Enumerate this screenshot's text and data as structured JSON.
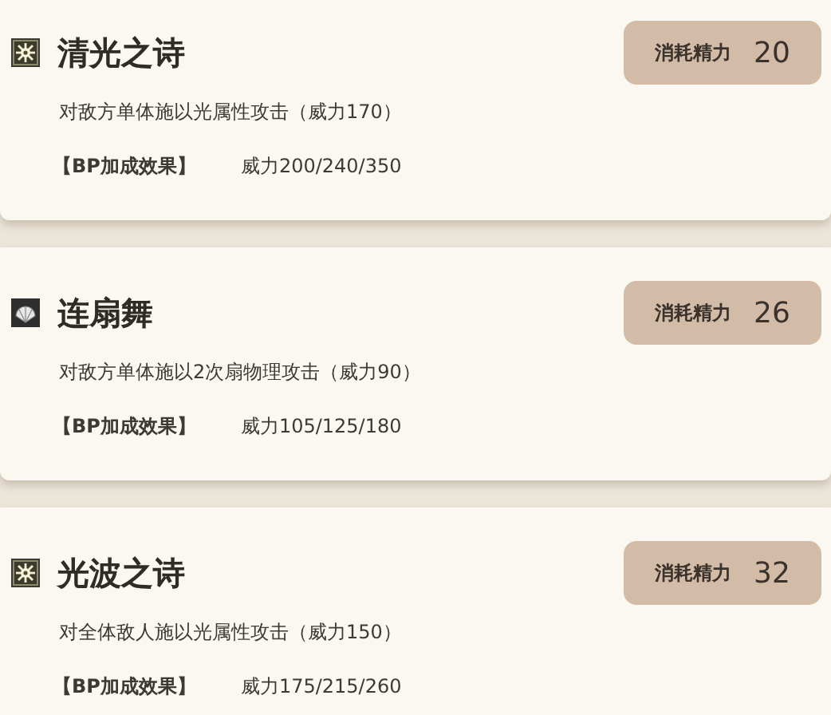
{
  "skills": [
    {
      "kind": "light",
      "name": "清光之诗",
      "cost_label": "消耗精力",
      "cost": "20",
      "description": "对敌方单体施以光属性攻击（威力170）",
      "bp_label": "【BP加成效果】",
      "bp_value": "威力200/240/350"
    },
    {
      "kind": "fan",
      "name": "连扇舞",
      "cost_label": "消耗精力",
      "cost": "26",
      "description": "对敌方单体施以2次扇物理攻击（威力90）",
      "bp_label": "【BP加成效果】",
      "bp_value": "威力105/125/180"
    },
    {
      "kind": "light",
      "name": "光波之诗",
      "cost_label": "消耗精力",
      "cost": "32",
      "description": "对全体敌人施以光属性攻击（威力150）",
      "bp_label": "【BP加成效果】",
      "bp_value": "威力175/215/260"
    }
  ]
}
